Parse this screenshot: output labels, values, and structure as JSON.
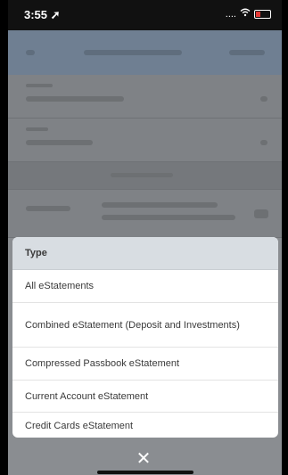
{
  "status": {
    "time": "3:55",
    "location_icon": "location-arrow-icon",
    "signal": "....",
    "wifi_icon": "wifi-icon",
    "battery_icon": "battery-low-icon"
  },
  "sheet": {
    "title": "Type",
    "options": [
      "All eStatements",
      "Combined eStatement (Deposit and Investments)",
      "Compressed Passbook eStatement",
      "Current Account eStatement",
      "Credit Cards eStatement"
    ]
  },
  "close_label": "✕",
  "colors": {
    "sheet_header": "#d8dde2",
    "backdrop": "#8a8d91"
  }
}
